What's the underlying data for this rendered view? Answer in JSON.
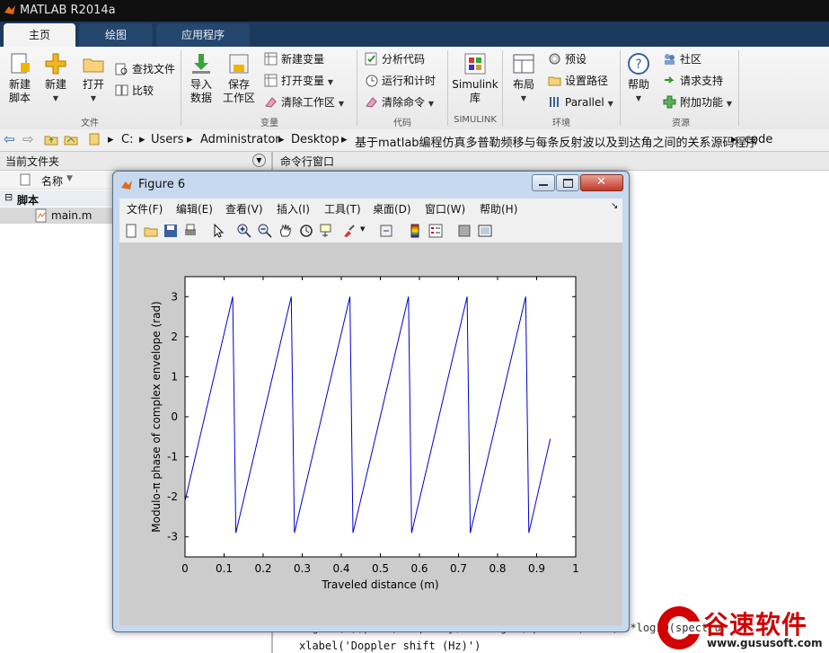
{
  "app": {
    "title": "MATLAB R2014a"
  },
  "tabs": [
    {
      "label": "主页"
    },
    {
      "label": "绘图"
    },
    {
      "label": "应用程序"
    }
  ],
  "ribbon": {
    "new_script": "新建\n脚本",
    "new": "新建",
    "open": "打开",
    "find_files": "查找文件",
    "compare": "比较",
    "group_file": "文件",
    "import_data": "导入\n数据",
    "save_workspace": "保存\n工作区",
    "new_variable": "新建变量",
    "open_variable": "打开变量",
    "clear_workspace": "清除工作区",
    "group_variable": "变量",
    "analyze_code": "分析代码",
    "run_and_time": "运行和计时",
    "clear_commands": "清除命令",
    "group_code": "代码",
    "simulink": "Simulink\n库",
    "group_simulink": "SIMULINK",
    "layout": "布局",
    "preferences": "预设",
    "set_path": "设置路径",
    "parallel": "Parallel",
    "group_env": "环境",
    "help": "帮助",
    "community": "社区",
    "request_support": "请求支持",
    "addons": "附加功能",
    "group_resources": "资源"
  },
  "address": {
    "path": [
      "C:",
      "Users",
      "Administrator",
      "Desktop",
      "基于matlab编程仿真多普勒频移与每条反射波以及到达角之间的关系源码程序",
      "code"
    ]
  },
  "left_panel": {
    "title": "当前文件夹",
    "column_name": "名称",
    "group": "脚本",
    "file": "main.m"
  },
  "command_window": {
    "title": "命令行窗口",
    "line1": "figure(7);plot(frequency, 10*log10(spectrum)-max(10*log10(spectrum",
    "line2": "xlabel('Doppler shift (Hz)')"
  },
  "figure": {
    "title": "Figure 6",
    "menu": [
      "文件(F)",
      "编辑(E)",
      "查看(V)",
      "插入(I)",
      "工具(T)",
      "桌面(D)",
      "窗口(W)",
      "帮助(H)"
    ],
    "toolbar_icons": [
      "new-figure-icon",
      "open-file-icon",
      "save-icon",
      "print-icon",
      "pointer-icon",
      "zoom-in-icon",
      "zoom-out-icon",
      "pan-icon",
      "rotate-icon",
      "data-cursor-icon",
      "brush-icon",
      "link-icon",
      "colorbar-icon",
      "legend-icon",
      "hide-plot-tools-icon",
      "show-plot-tools-icon"
    ]
  },
  "chart_data": {
    "type": "line",
    "xlabel": "Traveled distance (m)",
    "ylabel": "Modulo-π phase of complex envelope (rad)",
    "xlim": [
      0,
      1
    ],
    "ylim": [
      -3.5,
      3.5
    ],
    "xticks": [
      "0",
      "0.1",
      "0.2",
      "0.3",
      "0.4",
      "0.5",
      "0.6",
      "0.7",
      "0.8",
      "0.9",
      "1"
    ],
    "yticks": [
      "-3",
      "-2",
      "-1",
      "0",
      "1",
      "2",
      "3"
    ],
    "series": [
      {
        "color": "#0000cc",
        "x": [
          0,
          0.122,
          0.13,
          0.272,
          0.28,
          0.422,
          0.43,
          0.572,
          0.58,
          0.722,
          0.73,
          0.872,
          0.88,
          0.935
        ],
        "y": [
          -2.1,
          3.0,
          -2.9,
          3.0,
          -2.9,
          3.0,
          -2.9,
          3.0,
          -2.9,
          3.0,
          -2.9,
          3.0,
          -2.9,
          -0.55
        ]
      }
    ]
  },
  "watermark": {
    "brand": "谷速软件",
    "url": "www.gususoft.com"
  }
}
